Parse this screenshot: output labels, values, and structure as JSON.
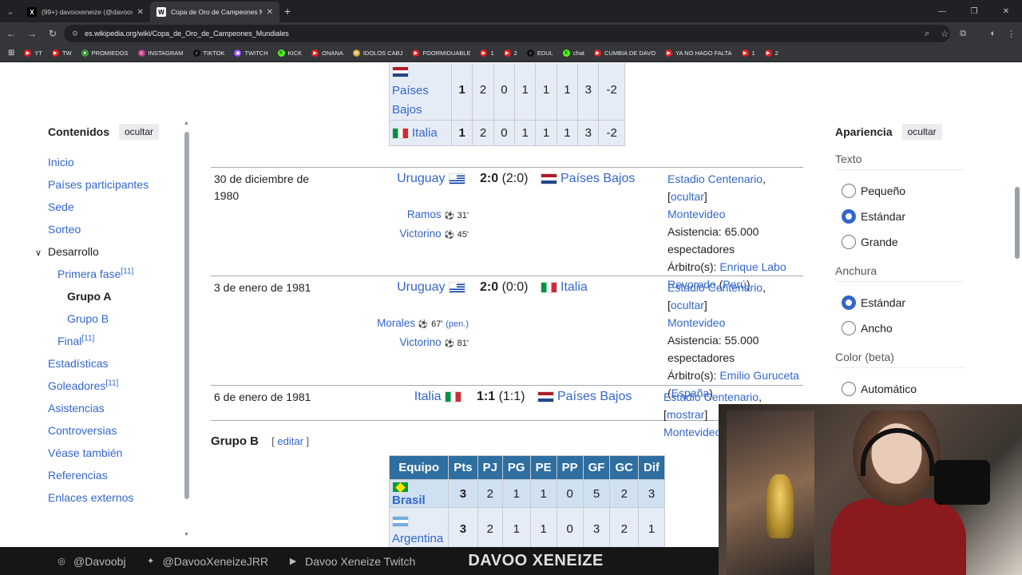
{
  "browser": {
    "tabs": [
      {
        "title": "(99+) davooxeneize (@davooxeneize)",
        "favicon": "X",
        "active": false
      },
      {
        "title": "Copa de Oro de Campeones Mundiales",
        "favicon": "W",
        "active": true
      }
    ],
    "url": "es.wikipedia.org/wiki/Copa_de_Oro_de_Campeones_Mundiales",
    "bookmarks": [
      "YT",
      "TW",
      "PROMIEDOS",
      "INSTAGRAM",
      "TIKTOK",
      "TWITCH",
      "KICK",
      "ONANA",
      "IDOLOS CABJ",
      "FOORMIDUABLE",
      "1",
      "2",
      "EDUL",
      "chat",
      "CUMBIA DE DAVO",
      "YA NO HAGO FALTA",
      "1",
      "2"
    ]
  },
  "toc": {
    "title": "Contenidos",
    "hide_label": "ocultar",
    "items": [
      {
        "label": "Inicio"
      },
      {
        "label": "Países participantes"
      },
      {
        "label": "Sede"
      },
      {
        "label": "Sorteo"
      },
      {
        "label": "Desarrollo"
      },
      {
        "label": "Primera fase",
        "sup": "[11]"
      },
      {
        "label": "Grupo A"
      },
      {
        "label": "Grupo B"
      },
      {
        "label": "Final",
        "sup": "[11]"
      },
      {
        "label": "Estadísticas"
      },
      {
        "label": "Goleadores",
        "sup": "[11]"
      },
      {
        "label": "Asistencias"
      },
      {
        "label": "Controversias"
      },
      {
        "label": "Véase también"
      },
      {
        "label": "Referencias"
      },
      {
        "label": "Enlaces externos"
      }
    ]
  },
  "group_a_table": {
    "rows": [
      {
        "team": [
          "Países",
          "Bajos"
        ],
        "pts": "1",
        "pj": "2",
        "pg": "0",
        "pe": "1",
        "pp": "1",
        "gf": "1",
        "gc": "3",
        "dif": "-2"
      },
      {
        "team": [
          "Italia"
        ],
        "pts": "1",
        "pj": "2",
        "pg": "0",
        "pe": "1",
        "pp": "1",
        "gf": "1",
        "gc": "3",
        "dif": "-2"
      }
    ]
  },
  "matches": [
    {
      "date": "30 de diciembre de 1980",
      "home": "Uruguay",
      "score": "2:0",
      "ht": "(2:0)",
      "away": "Países Bajos",
      "scorers": [
        {
          "name": "Ramos",
          "min": "31'"
        },
        {
          "name": "Victorino",
          "min": "45'"
        }
      ],
      "stadium": "Estadio Centenario",
      "toggle": "ocultar",
      "city": "Montevideo",
      "attendance": "Asistencia: 65.000 espectadores",
      "referee_label": "Árbitro(s):",
      "referee": "Enrique Labo Revoredo",
      "ref_country": "Perú"
    },
    {
      "date": "3 de enero de 1981",
      "home": "Uruguay",
      "score": "2:0",
      "ht": "(0:0)",
      "away": "Italia",
      "scorers": [
        {
          "name": "Morales",
          "min": "67'",
          "pen": "(pen.)"
        },
        {
          "name": "Victorino",
          "min": "81'"
        }
      ],
      "stadium": "Estadio Centenario",
      "toggle": "ocultar",
      "city": "Montevideo",
      "attendance": "Asistencia: 55.000 espectadores",
      "referee_label": "Árbitro(s):",
      "referee": "Emilio Guruceta",
      "ref_country": "España"
    },
    {
      "date": "6 de enero de 1981",
      "home": "Italia",
      "score": "1:1",
      "ht": "(1:1)",
      "away": "Países Bajos",
      "stadium": "Estadio Centenario",
      "toggle": "mostrar",
      "city": "Montevideo"
    }
  ],
  "group_b": {
    "heading": "Grupo B",
    "edit_label": "editar",
    "headers": [
      "Equipo",
      "Pts",
      "PJ",
      "PG",
      "PE",
      "PP",
      "GF",
      "GC",
      "Dif"
    ],
    "rows": [
      {
        "team": "Brasil",
        "pts": "3",
        "pj": "2",
        "pg": "1",
        "pe": "1",
        "pp": "0",
        "gf": "5",
        "gc": "2",
        "dif": "3"
      },
      {
        "team": "Argentina",
        "pts": "3",
        "pj": "2",
        "pg": "1",
        "pe": "1",
        "pp": "0",
        "gf": "3",
        "gc": "2",
        "dif": "1"
      }
    ]
  },
  "appearance": {
    "title": "Apariencia",
    "hide_label": "ocultar",
    "text_label": "Texto",
    "text_options": [
      "Pequeño",
      "Estándar",
      "Grande"
    ],
    "width_label": "Anchura",
    "width_options": [
      "Estándar",
      "Ancho"
    ],
    "color_label": "Color (beta)",
    "color_options": [
      "Automático"
    ]
  },
  "footer": {
    "instagram": "@Davoobj",
    "twitter": "@DavooXeneizeJRR",
    "youtube": "Davoo Xeneize Twitch",
    "brand": "DAVOO XENEIZE"
  }
}
